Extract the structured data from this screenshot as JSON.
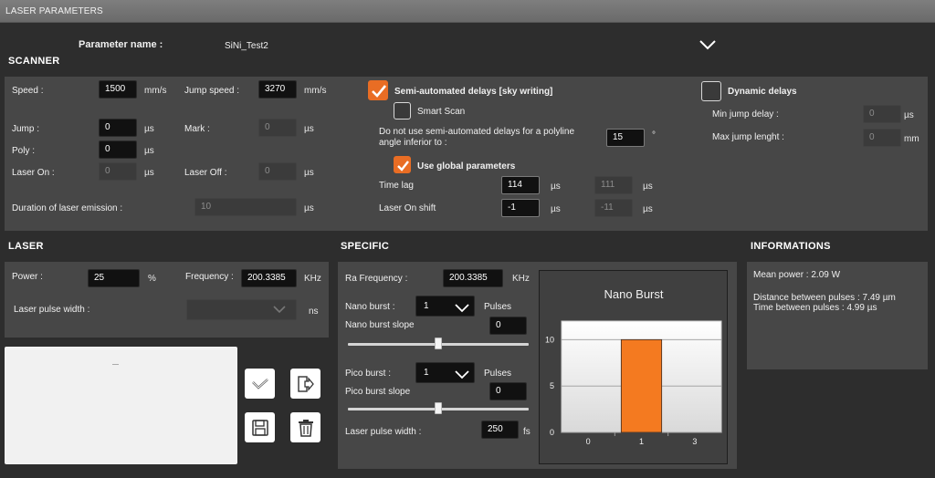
{
  "window": {
    "title": "LASER PARAMETERS"
  },
  "param": {
    "label": "Parameter name :",
    "value": "SiNi_Test2"
  },
  "scanner": {
    "title": "SCANNER",
    "speed_label": "Speed :",
    "speed_value": "1500",
    "speed_unit": "mm/s",
    "jumpspeed_label": "Jump speed :",
    "jumpspeed_value": "3270",
    "jumpspeed_unit": "mm/s",
    "jump_label": "Jump :",
    "jump_value": "0",
    "jump_unit": "µs",
    "mark_label": "Mark :",
    "mark_value": "0",
    "mark_unit": "µs",
    "poly_label": "Poly :",
    "poly_value": "0",
    "poly_unit": "µs",
    "laseron_label": "Laser On :",
    "laseron_value": "0",
    "laseron_unit": "µs",
    "laseroff_label": "Laser Off :",
    "laseroff_value": "0",
    "laseroff_unit": "µs",
    "duration_label": "Duration of laser emission :",
    "duration_value": "10",
    "duration_unit": "µs",
    "semi_label": "Semi-automated delays [sky writing]",
    "smart_label": "Smart Scan",
    "angle_label": "Do not use semi-automated delays for a polyline angle inferior to :",
    "angle_value": "15",
    "angle_unit": "°",
    "global_label": "Use global parameters",
    "timelag_label": "Time lag",
    "timelag_value": "114",
    "timelag_unit": "µs",
    "timelag_value2": "111",
    "timelag_unit2": "µs",
    "shift_label": "Laser On shift",
    "shift_value": "-1",
    "shift_unit": "µs",
    "shift_value2": "-11",
    "shift_unit2": "µs",
    "dynamic_label": "Dynamic delays",
    "minjump_label": "Min jump delay :",
    "minjump_value": "0",
    "minjump_unit": "µs",
    "maxjump_label": "Max jump lenght :",
    "maxjump_value": "0",
    "maxjump_unit": "mm"
  },
  "laser": {
    "title": "LASER",
    "power_label": "Power :",
    "power_value": "25",
    "power_unit": "%",
    "freq_label": "Frequency :",
    "freq_value": "200.3385",
    "freq_unit": "KHz",
    "pulse_label": "Laser pulse width :",
    "pulse_value": "",
    "pulse_unit": "ns"
  },
  "specific": {
    "title": "SPECIFIC",
    "rafreq_label": "Ra Frequency :",
    "rafreq_value": "200.3385",
    "rafreq_unit": "KHz",
    "nano_label": "Nano burst :",
    "nano_value": "1",
    "nano_unit": "Pulses",
    "nanoslope_label": "Nano burst slope",
    "nanoslope_value": "0",
    "pico_label": "Pico burst :",
    "pico_value": "1",
    "pico_unit": "Pulses",
    "picoslope_label": "Pico burst slope",
    "picoslope_value": "0",
    "lpw_label": "Laser pulse width :",
    "lpw_value": "250",
    "lpw_unit": "fs"
  },
  "info": {
    "title": "INFORMATIONS",
    "mean_power": "Mean power : 2.09 W",
    "distance": "Distance between pulses : 7.49 µm",
    "time": "Time between pulses : 4.99 µs"
  },
  "chart_data": {
    "type": "bar",
    "title": "Nano Burst",
    "categories": [
      "1"
    ],
    "values": [
      10
    ],
    "x_ticks": [
      "0",
      "1",
      "3"
    ],
    "y_ticks": [
      "0",
      "5",
      "10"
    ],
    "ylim": [
      0,
      12
    ],
    "bar_color": "#f47a20",
    "grid": true
  },
  "colors": {
    "accent": "#e96d24",
    "panel": "#474747",
    "background": "#2d2d2d"
  },
  "icons": {
    "validate": "check-icon",
    "export": "export-icon",
    "save": "save-icon",
    "delete": "trash-icon",
    "dropdown": "chevron-down-icon"
  }
}
